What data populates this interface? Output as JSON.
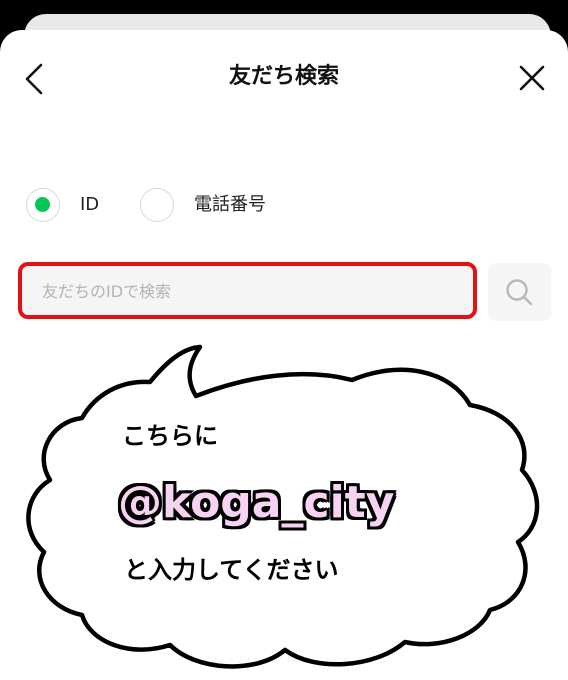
{
  "screen": {
    "title": "友だち検索",
    "back_icon": "chevron-left-icon",
    "close_icon": "close-icon"
  },
  "search_type": {
    "options": [
      {
        "label": "ID",
        "selected": true
      },
      {
        "label": "電話番号",
        "selected": false
      }
    ],
    "selected_color": "#06c755"
  },
  "search": {
    "placeholder": "友だちのIDで検索",
    "value": "",
    "button_icon": "search-icon",
    "highlight_color": "#e41111"
  },
  "callout": {
    "line1": "こちらに",
    "line2": "@koga_city",
    "line3": "と入力してください",
    "highlight_text_color": "#f6d3f3"
  }
}
